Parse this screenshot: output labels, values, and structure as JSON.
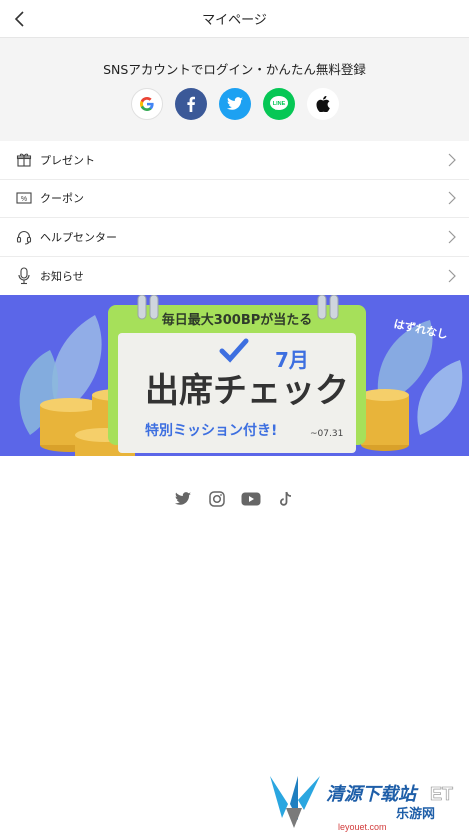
{
  "header": {
    "title": "マイページ"
  },
  "sns_login": {
    "title": "SNSアカウントでログイン・かんたん無料登録",
    "buttons": [
      {
        "id": "google",
        "label": "G"
      },
      {
        "id": "facebook",
        "label": "f"
      },
      {
        "id": "twitter",
        "label": ""
      },
      {
        "id": "line",
        "label": "LINE"
      },
      {
        "id": "apple",
        "label": ""
      }
    ]
  },
  "menu": {
    "items": [
      {
        "label": "プレゼント",
        "icon": "gift-icon"
      },
      {
        "label": "クーポン",
        "icon": "coupon-icon"
      },
      {
        "label": "ヘルプセンター",
        "icon": "headset-icon"
      },
      {
        "label": "お知らせ",
        "icon": "microphone-icon"
      }
    ]
  },
  "banner": {
    "top_text": "毎日最大300BPが当たる",
    "tag": "はずれなし",
    "main_text": "出席チェック",
    "month": "7月",
    "sub_text": "特別ミッション付き!",
    "date": "~07.31",
    "colors": {
      "background": "#5b66e8",
      "board": "#a6e05a",
      "title": "#333333",
      "accent": "#3d6fe0"
    }
  },
  "social": [
    "twitter-icon",
    "instagram-icon",
    "youtube-icon",
    "tiktok-icon"
  ],
  "watermark": {
    "text1": "清源下载站",
    "text2": "乐游网",
    "text3": "ET",
    "url": "leyouet.com"
  }
}
